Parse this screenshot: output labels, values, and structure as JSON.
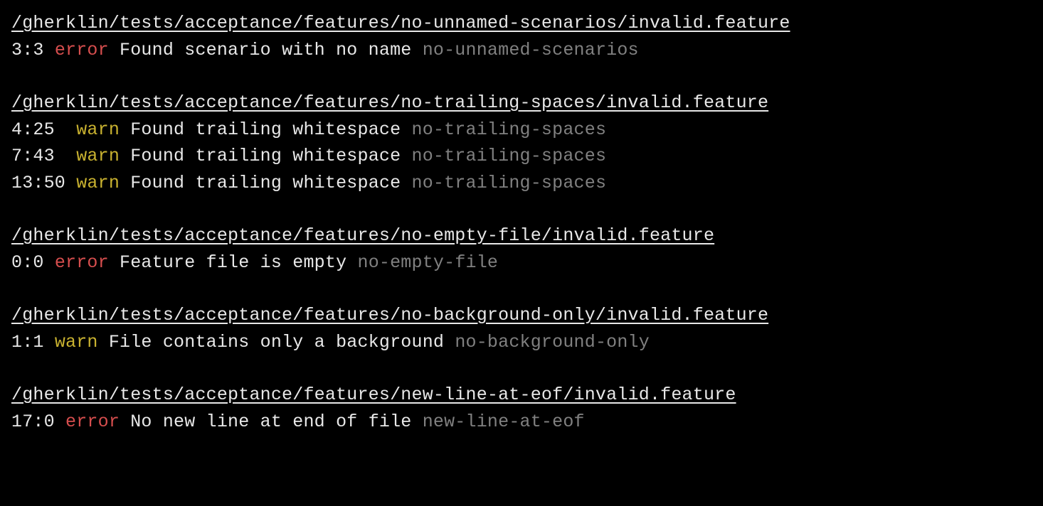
{
  "groups": [
    {
      "path": "/gherklin/tests/acceptance/features/no-unnamed-scenarios/invalid.feature",
      "issues": [
        {
          "linecol": "3:3",
          "severity": "error",
          "message": "Found scenario with no name",
          "rule": "no-unnamed-scenarios"
        }
      ]
    },
    {
      "path": "/gherklin/tests/acceptance/features/no-trailing-spaces/invalid.feature",
      "issues": [
        {
          "linecol": "4:25 ",
          "severity": "warn",
          "message": "Found trailing whitespace",
          "rule": "no-trailing-spaces"
        },
        {
          "linecol": "7:43 ",
          "severity": "warn",
          "message": "Found trailing whitespace",
          "rule": "no-trailing-spaces"
        },
        {
          "linecol": "13:50",
          "severity": "warn",
          "message": "Found trailing whitespace",
          "rule": "no-trailing-spaces"
        }
      ]
    },
    {
      "path": "/gherklin/tests/acceptance/features/no-empty-file/invalid.feature",
      "issues": [
        {
          "linecol": "0:0",
          "severity": "error",
          "message": "Feature file is empty",
          "rule": "no-empty-file"
        }
      ]
    },
    {
      "path": "/gherklin/tests/acceptance/features/no-background-only/invalid.feature",
      "issues": [
        {
          "linecol": "1:1",
          "severity": "warn",
          "message": "File contains only a background",
          "rule": "no-background-only"
        }
      ]
    },
    {
      "path": "/gherklin/tests/acceptance/features/new-line-at-eof/invalid.feature",
      "issues": [
        {
          "linecol": "17:0",
          "severity": "error",
          "message": "No new line at end of file",
          "rule": "new-line-at-eof"
        }
      ]
    }
  ]
}
